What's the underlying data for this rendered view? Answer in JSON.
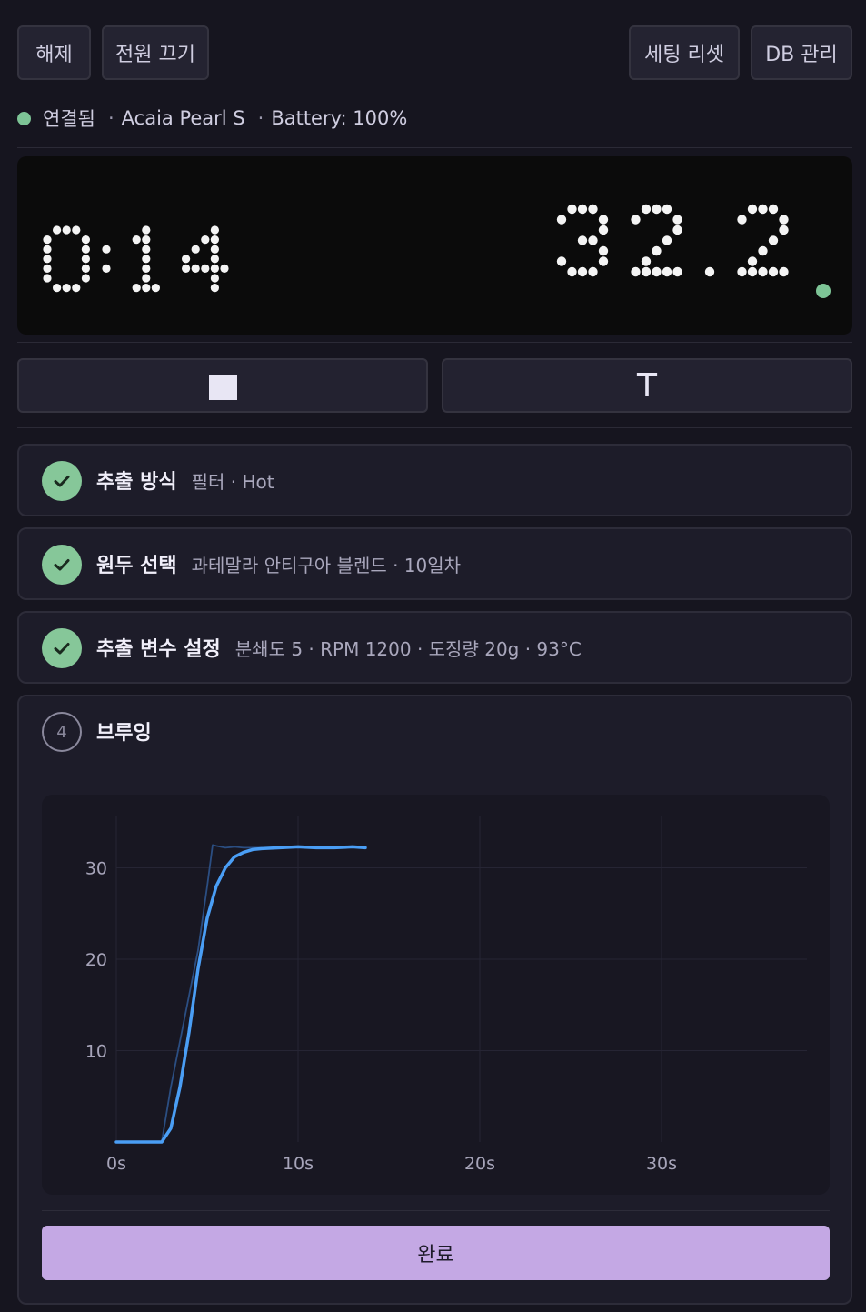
{
  "header": {
    "disconnect_label": "해제",
    "power_off_label": "전원 끄기",
    "reset_settings_label": "세팅 리셋",
    "db_manage_label": "DB 관리"
  },
  "status": {
    "connection": "연결됨",
    "device": "Acaia Pearl S",
    "battery": "Battery: 100%",
    "color": "#7dc496"
  },
  "display": {
    "timer": "0:14",
    "weight": "32.2",
    "indicator_color": "#7dc496"
  },
  "controls": {
    "stop_icon": "stop-square-icon",
    "tare_label": "T"
  },
  "steps": [
    {
      "title": "추출 방식",
      "summary": "필터 · Hot",
      "state": "done"
    },
    {
      "title": "원두 선택",
      "summary": "과테말라 안티구아 블렌드 · 10일차",
      "state": "done"
    },
    {
      "title": "추출 변수 설정",
      "summary": "분쇄도 5 · RPM 1200 · 도징량 20g · 93°C",
      "state": "done"
    }
  ],
  "brew": {
    "number": "4",
    "title": "브루잉",
    "done_label": "완료",
    "accent": "#c4a8e4"
  },
  "chart_data": {
    "type": "line",
    "xlim": [
      0,
      40
    ],
    "ylim": [
      0,
      35
    ],
    "x_ticks": [
      "0s",
      "10s",
      "20s",
      "30s"
    ],
    "y_ticks": [
      "10",
      "20",
      "30"
    ],
    "grid": true,
    "series": [
      {
        "color": "#4a9ef5",
        "x": [
          0,
          1,
          2,
          2.5,
          3,
          3.5,
          4,
          4.5,
          5,
          5.5,
          6,
          6.5,
          7,
          7.5,
          8,
          9,
          10,
          11,
          12,
          13,
          13.7
        ],
        "y": [
          0,
          0,
          0,
          0,
          1.5,
          6,
          12,
          19,
          24.5,
          28,
          30,
          31.2,
          31.7,
          32,
          32.1,
          32.2,
          32.3,
          32.2,
          32.2,
          32.3,
          32.2
        ]
      },
      {
        "color": "#2b4e82",
        "x": [
          0,
          1,
          2,
          2.5,
          3,
          3.5,
          4,
          4.5,
          5,
          5.3,
          5.5,
          6,
          6.5,
          7,
          8
        ],
        "y": [
          0,
          0,
          0,
          0,
          6,
          11,
          16,
          21,
          28,
          32.5,
          32.4,
          32.2,
          32.3,
          32.2,
          32.2
        ]
      }
    ]
  }
}
